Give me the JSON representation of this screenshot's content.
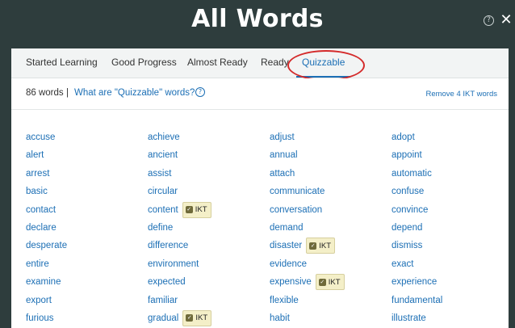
{
  "header": {
    "title": "All Words",
    "help_icon": "question-circle-icon",
    "close_icon": "close-icon"
  },
  "tabs": [
    {
      "label": "Started Learning",
      "active": false
    },
    {
      "label": "Good Progress",
      "active": false
    },
    {
      "label": "Almost Ready",
      "active": false
    },
    {
      "label": "Ready",
      "active": false
    },
    {
      "label": "Quizzable",
      "active": true
    }
  ],
  "info": {
    "count": "86 words",
    "separator": "|",
    "what_link": "What are \"Quizzable\" words?",
    "remove_link": "Remove 4 IKT words"
  },
  "badge_label": "IKT",
  "colors": {
    "header_bg": "#2e3d3d",
    "link": "#1c6fb5",
    "annotation": "#d42a2a",
    "badge_bg": "#f4efc8"
  },
  "words": [
    [
      {
        "text": "accuse"
      },
      {
        "text": "achieve"
      },
      {
        "text": "adjust"
      },
      {
        "text": "adopt"
      }
    ],
    [
      {
        "text": "alert"
      },
      {
        "text": "ancient"
      },
      {
        "text": "annual"
      },
      {
        "text": "appoint"
      }
    ],
    [
      {
        "text": "arrest"
      },
      {
        "text": "assist"
      },
      {
        "text": "attach"
      },
      {
        "text": "automatic"
      }
    ],
    [
      {
        "text": "basic"
      },
      {
        "text": "circular"
      },
      {
        "text": "communicate"
      },
      {
        "text": "confuse"
      }
    ],
    [
      {
        "text": "contact"
      },
      {
        "text": "content",
        "ikt": true
      },
      {
        "text": "conversation"
      },
      {
        "text": "convince"
      }
    ],
    [
      {
        "text": "declare"
      },
      {
        "text": "define"
      },
      {
        "text": "demand"
      },
      {
        "text": "depend"
      }
    ],
    [
      {
        "text": "desperate"
      },
      {
        "text": "difference"
      },
      {
        "text": "disaster",
        "ikt": true
      },
      {
        "text": "dismiss"
      }
    ],
    [
      {
        "text": "entire"
      },
      {
        "text": "environment"
      },
      {
        "text": "evidence"
      },
      {
        "text": "exact"
      }
    ],
    [
      {
        "text": "examine"
      },
      {
        "text": "expected"
      },
      {
        "text": "expensive",
        "ikt": true
      },
      {
        "text": "experience"
      }
    ],
    [
      {
        "text": "export"
      },
      {
        "text": "familiar"
      },
      {
        "text": "flexible"
      },
      {
        "text": "fundamental"
      }
    ],
    [
      {
        "text": "furious"
      },
      {
        "text": "gradual",
        "ikt": true
      },
      {
        "text": "habit"
      },
      {
        "text": "illustrate"
      }
    ]
  ]
}
